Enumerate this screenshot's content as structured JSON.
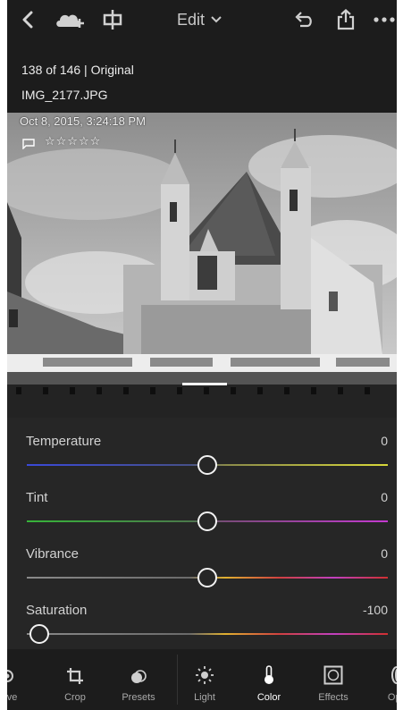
{
  "topbar": {
    "menu_title": "Edit",
    "icons": [
      "back-chevron-icon",
      "cloud-add-icon",
      "compare-icon",
      "chevron-down-icon",
      "undo-icon",
      "share-icon",
      "more-icon"
    ]
  },
  "info": {
    "count_line": "138 of 146 | Original",
    "filename": "IMG_2177.JPG",
    "date": "Oct 8, 2015, 3:24:18 PM",
    "rating_text": "☆☆☆☆☆",
    "rating": 0
  },
  "adjustments": [
    {
      "label": "Temperature",
      "value": "0",
      "position": 0.5
    },
    {
      "label": "Tint",
      "value": "0",
      "position": 0.5
    },
    {
      "label": "Vibrance",
      "value": "0",
      "position": 0.5
    },
    {
      "label": "Saturation",
      "value": "-100",
      "position": 0.0
    }
  ],
  "tools": [
    {
      "label": "ctive",
      "icon": "selective-icon"
    },
    {
      "label": "Crop",
      "icon": "crop-icon"
    },
    {
      "label": "Presets",
      "icon": "presets-icon"
    },
    {
      "label": "Light",
      "icon": "light-icon"
    },
    {
      "label": "Color",
      "icon": "color-icon",
      "active": true
    },
    {
      "label": "Effects",
      "icon": "effects-icon"
    },
    {
      "label": "Opti",
      "icon": "optics-icon"
    }
  ],
  "colors": {
    "background": "#1c1c1c",
    "panel": "#262626",
    "text": "#d2d2d2",
    "active_label": "#ffffff"
  }
}
